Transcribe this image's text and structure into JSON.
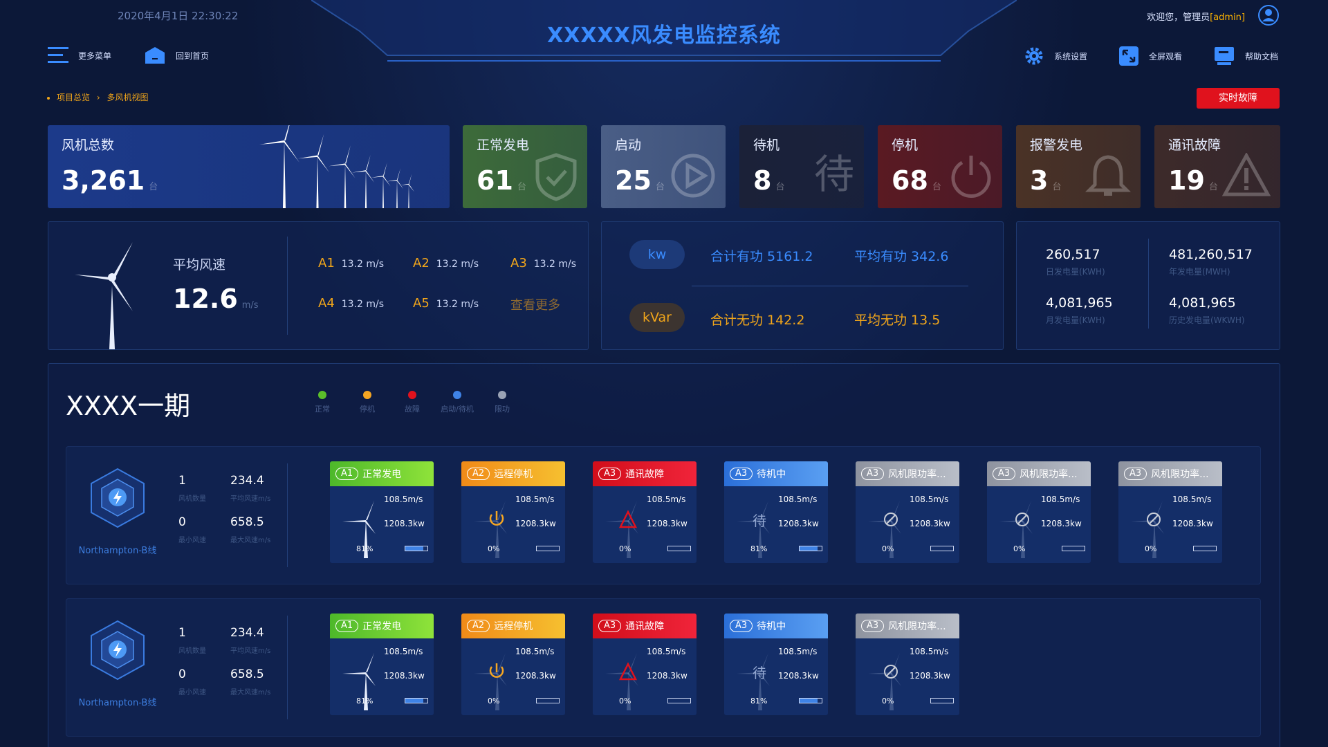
{
  "header": {
    "datetime": "2020年4月1日 22:30:22",
    "title": "XXXXX风发电监控系统",
    "welcome_prefix": "欢迎您，管理员",
    "welcome_user": "[admin]"
  },
  "nav": {
    "more_menu": "更多菜单",
    "home": "回到首页",
    "settings": "系统设置",
    "fullscreen": "全屏观看",
    "help": "帮助文档"
  },
  "breadcrumb": {
    "root": "项目总览",
    "sep": "›",
    "current": "多风机视图"
  },
  "fault_button": "实时故障",
  "summary_cards": [
    {
      "label": "风机总数",
      "value": "3,261",
      "unit": "台",
      "color": "#1c3a8a",
      "icon": "wind-turbines-icon"
    },
    {
      "label": "正常发电",
      "value": "61",
      "unit": "台",
      "color": "#3d6b3a",
      "icon": "shield-check-icon"
    },
    {
      "label": "启动",
      "value": "25",
      "unit": "台",
      "color": "#4a5e86",
      "icon": "play-circle-icon"
    },
    {
      "label": "待机",
      "value": "8",
      "unit": "台",
      "color": "#1b2138",
      "icon": "standby-char-icon",
      "icon_char": "待"
    },
    {
      "label": "停机",
      "value": "68",
      "unit": "台",
      "color": "#5a1a22",
      "icon": "power-icon"
    },
    {
      "label": "报警发电",
      "value": "3",
      "unit": "台",
      "color": "#4a3226",
      "icon": "bell-icon"
    },
    {
      "label": "通讯故障",
      "value": "19",
      "unit": "台",
      "color": "#3d2a2a",
      "icon": "warning-icon"
    }
  ],
  "wind_panel": {
    "label": "平均风速",
    "value": "12.6",
    "unit": "m/s",
    "items": [
      {
        "k": "A1",
        "v": "13.2 m/s"
      },
      {
        "k": "A2",
        "v": "13.2 m/s"
      },
      {
        "k": "A3",
        "v": "13.2 m/s"
      },
      {
        "k": "A4",
        "v": "13.2 m/s"
      },
      {
        "k": "A5",
        "v": "13.2 m/s"
      }
    ],
    "more": "查看更多"
  },
  "power_panel": {
    "kw_label": "kw",
    "kw_total": "合计有功  5161.2",
    "kw_avg": "平均有功  342.6",
    "kvar_label": "kVar",
    "kvar_total": "合计无功  142.2",
    "kvar_avg": "平均无功  13.5"
  },
  "energy_panel": [
    {
      "value": "260,517",
      "label": "日发电量(KWH)"
    },
    {
      "value": "481,260,517",
      "label": "年发电量(MWH)"
    },
    {
      "value": "4,081,965",
      "label": "月发电量(KWH)"
    },
    {
      "value": "4,081,965",
      "label": "历史发电量(WKWH)"
    }
  ],
  "section": {
    "title": "XXXX一期",
    "legend": [
      {
        "label": "正常",
        "color": "#5bbf2a"
      },
      {
        "label": "停机",
        "color": "#f5a623"
      },
      {
        "label": "故障",
        "color": "#e0121d"
      },
      {
        "label": "启动/待机",
        "color": "#3f83e6"
      },
      {
        "label": "限功",
        "color": "#9aa3b5"
      }
    ]
  },
  "rows": [
    {
      "line_name": "Northampton-B线",
      "stats": [
        {
          "v": "1",
          "l": "风机数量"
        },
        {
          "v": "234.4",
          "l": "平均风速m/s"
        },
        {
          "v": "0",
          "l": "最小风速"
        },
        {
          "v": "658.5",
          "l": "最大风速m/s"
        }
      ],
      "turbines": [
        {
          "tag": "A1",
          "status": "正常发电",
          "kind": "ok",
          "speed": "108.5m/s",
          "power": "1208.3kw",
          "pct": "81%",
          "fill": 0.81
        },
        {
          "tag": "A2",
          "status": "远程停机",
          "kind": "stop",
          "speed": "108.5m/s",
          "power": "1208.3kw",
          "pct": "0%",
          "fill": 0
        },
        {
          "tag": "A3",
          "status": "通讯故障",
          "kind": "fault",
          "speed": "108.5m/s",
          "power": "1208.3kw",
          "pct": "0%",
          "fill": 0
        },
        {
          "tag": "A3",
          "status": "待机中",
          "kind": "standby",
          "speed": "108.5m/s",
          "power": "1208.3kw",
          "pct": "81%",
          "fill": 0.81
        },
        {
          "tag": "A3",
          "status": "风机限功率...",
          "kind": "limit",
          "speed": "108.5m/s",
          "power": "1208.3kw",
          "pct": "0%",
          "fill": 0
        },
        {
          "tag": "A3",
          "status": "风机限功率...",
          "kind": "limit",
          "speed": "108.5m/s",
          "power": "1208.3kw",
          "pct": "0%",
          "fill": 0
        },
        {
          "tag": "A3",
          "status": "风机限功率...",
          "kind": "limit",
          "speed": "108.5m/s",
          "power": "1208.3kw",
          "pct": "0%",
          "fill": 0
        }
      ]
    },
    {
      "line_name": "Northampton-B线",
      "stats": [
        {
          "v": "1",
          "l": "风机数量"
        },
        {
          "v": "234.4",
          "l": "平均风速m/s"
        },
        {
          "v": "0",
          "l": "最小风速"
        },
        {
          "v": "658.5",
          "l": "最大风速m/s"
        }
      ],
      "turbines": [
        {
          "tag": "A1",
          "status": "正常发电",
          "kind": "ok",
          "speed": "108.5m/s",
          "power": "1208.3kw",
          "pct": "81%",
          "fill": 0.81
        },
        {
          "tag": "A2",
          "status": "远程停机",
          "kind": "stop",
          "speed": "108.5m/s",
          "power": "1208.3kw",
          "pct": "0%",
          "fill": 0
        },
        {
          "tag": "A3",
          "status": "通讯故障",
          "kind": "fault",
          "speed": "108.5m/s",
          "power": "1208.3kw",
          "pct": "0%",
          "fill": 0
        },
        {
          "tag": "A3",
          "status": "待机中",
          "kind": "standby",
          "speed": "108.5m/s",
          "power": "1208.3kw",
          "pct": "81%",
          "fill": 0.81
        },
        {
          "tag": "A3",
          "status": "风机限功率...",
          "kind": "limit",
          "speed": "108.5m/s",
          "power": "1208.3kw",
          "pct": "0%",
          "fill": 0
        }
      ]
    }
  ],
  "colors": {
    "accent": "#3a8cff",
    "ok": "#62c52c",
    "stop": "#f5a623",
    "fault": "#e0121d",
    "standby": "#3f83e6",
    "limit": "#a4a9b5"
  }
}
